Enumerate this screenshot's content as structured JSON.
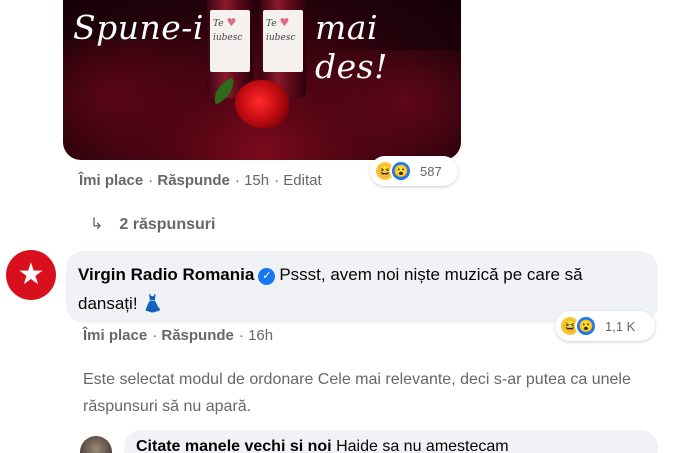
{
  "post": {
    "image_text_left": "Spune-i",
    "image_text_right": "mai des!",
    "bottle_label_top": "Te",
    "bottle_label_bottom": "iubesc"
  },
  "post_actions": {
    "like": "Îmi place",
    "reply": "Răspunde",
    "time": "15h",
    "edited": "Editat",
    "reaction_count": "587"
  },
  "replies_link": "2 răspunsuri",
  "comment": {
    "author": "Virgin Radio Romania",
    "text": "Pssst, avem noi niște muzică pe care să dansați!",
    "like": "Îmi place",
    "reply": "Răspunde",
    "time": "16h",
    "reaction_count": "1,1 K"
  },
  "sort_notice": "Este selectat modul de ordonare Cele mai relevante, deci s-ar putea ca unele răspunsuri să nu apară.",
  "next_comment": {
    "author": "Citate manele vechi si noi",
    "text": "Haide sa nu amestecam"
  },
  "icons": {
    "reaction1": "haha-icon",
    "reaction2": "wow-icon",
    "verified": "verified-badge-icon",
    "reply_arrow": "reply-arrow-icon",
    "dress_emoji": "dress-emoji-icon"
  },
  "colors": {
    "accent": "#1877f2",
    "secondary_text": "#65676b",
    "bubble": "#f0f2f5",
    "brand_red": "#d8101e"
  }
}
